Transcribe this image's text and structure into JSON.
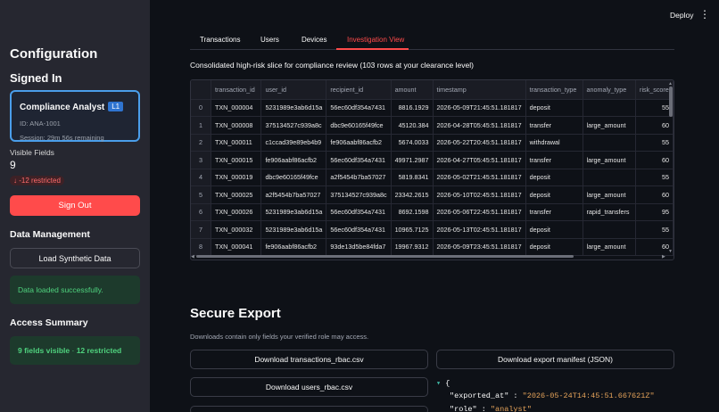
{
  "sidebar": {
    "title": "Configuration",
    "signed_in_header": "Signed In",
    "role": {
      "name": "Compliance Analyst",
      "badge": "L1",
      "id_text": "ID: ANA-1001",
      "session_text": "Session: 29m 56s remaining"
    },
    "visible_fields": {
      "label": "Visible Fields",
      "value": "9",
      "delta": "-12 restricted"
    },
    "sign_out_label": "Sign Out",
    "data_management_header": "Data Management",
    "load_button_label": "Load Synthetic Data",
    "load_success": "Data loaded successfully.",
    "access_summary_header": "Access Summary",
    "access_summary": {
      "visible": "9 fields visible",
      "separator": " · ",
      "restricted": "12 restricted"
    }
  },
  "topbar": {
    "deploy_label": "Deploy",
    "menu_icon": "kebab-menu-icon"
  },
  "tabs": [
    {
      "label": "Transactions",
      "active": false
    },
    {
      "label": "Users",
      "active": false
    },
    {
      "label": "Devices",
      "active": false
    },
    {
      "label": "Investigation View",
      "active": true
    }
  ],
  "caption": "Consolidated high-risk slice for compliance review (103 rows at your clearance level)",
  "table": {
    "columns": [
      "",
      "transaction_id",
      "user_id",
      "recipient_id",
      "amount",
      "timestamp",
      "transaction_type",
      "anomaly_type",
      "risk_score"
    ],
    "rows": [
      [
        "0",
        "TXN_000004",
        "5231989e3ab6d15a",
        "56ec60df354a7431",
        "8816.1929",
        "2026-05-09T21:45:51.181817",
        "deposit",
        "",
        "55"
      ],
      [
        "1",
        "TXN_000008",
        "375134527c939a8c",
        "dbc9e60165f49fce",
        "45120.384",
        "2026-04-28T05:45:51.181817",
        "transfer",
        "large_amount",
        "60"
      ],
      [
        "2",
        "TXN_000011",
        "c1ccad39e89eb4b9",
        "fe906aabf86acfb2",
        "5674.0033",
        "2026-05-22T20:45:51.181817",
        "withdrawal",
        "",
        "55"
      ],
      [
        "3",
        "TXN_000015",
        "fe906aabf86acfb2",
        "56ec60df354a7431",
        "49971.2987",
        "2026-04-27T05:45:51.181817",
        "transfer",
        "large_amount",
        "60"
      ],
      [
        "4",
        "TXN_000019",
        "dbc9e60165f49fce",
        "a2f5454b7ba57027",
        "5819.8341",
        "2026-05-02T21:45:51.181817",
        "deposit",
        "",
        "55"
      ],
      [
        "5",
        "TXN_000025",
        "a2f5454b7ba57027",
        "375134527c939a8c",
        "23342.2615",
        "2026-05-10T02:45:51.181817",
        "deposit",
        "large_amount",
        "60"
      ],
      [
        "6",
        "TXN_000026",
        "5231989e3ab6d15a",
        "56ec60df354a7431",
        "8692.1598",
        "2026-05-06T22:45:51.181817",
        "transfer",
        "rapid_transfers",
        "95"
      ],
      [
        "7",
        "TXN_000032",
        "5231989e3ab6d15a",
        "56ec60df354a7431",
        "10965.7125",
        "2026-05-13T02:45:51.181817",
        "deposit",
        "",
        "55"
      ],
      [
        "8",
        "TXN_000041",
        "fe906aabf86acfb2",
        "93de13d5be84fda7",
        "19967.9312",
        "2026-05-09T23:45:51.181817",
        "deposit",
        "large_amount",
        "60"
      ]
    ]
  },
  "export": {
    "title": "Secure Export",
    "subtitle": "Downloads contain only fields your verified role may access.",
    "btn_transactions": "Download transactions_rbac.csv",
    "btn_manifest": "Download export manifest (JSON)",
    "btn_users": "Download users_rbac.csv",
    "json": {
      "open_brace": "{",
      "key1": "\"exported_at\"",
      "val1": "\"2026-05-24T14:45:51.667621Z\"",
      "key2": "\"role\"",
      "val2": "\"analyst\""
    }
  }
}
